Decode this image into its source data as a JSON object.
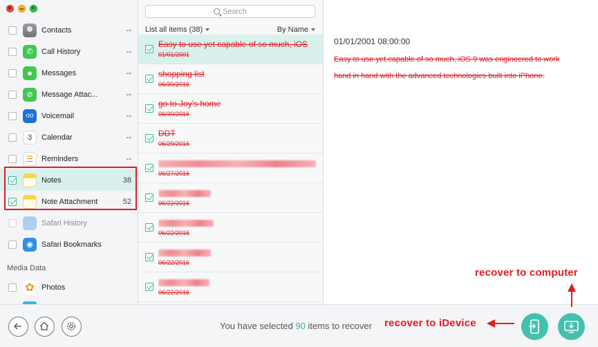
{
  "sidebar": {
    "items": [
      {
        "label": "Contacts",
        "count": "--",
        "checked": false
      },
      {
        "label": "Call History",
        "count": "--",
        "checked": false
      },
      {
        "label": "Messages",
        "count": "--",
        "checked": false
      },
      {
        "label": "Message Attac...",
        "count": "--",
        "checked": false
      },
      {
        "label": "Voicemail",
        "count": "--",
        "checked": false
      },
      {
        "label": "Calendar",
        "count": "--",
        "checked": false
      },
      {
        "label": "Reminders",
        "count": "--",
        "checked": false
      },
      {
        "label": "Notes",
        "count": "38",
        "checked": true
      },
      {
        "label": "Note Attachment",
        "count": "52",
        "checked": true
      },
      {
        "label": "Safari History",
        "count": "--",
        "checked": false
      },
      {
        "label": "Safari Bookmarks",
        "count": "--",
        "checked": false
      },
      {
        "label": "Photos",
        "count": "--",
        "checked": false
      }
    ],
    "section_media": "Media Data",
    "calendar_day": "3"
  },
  "list": {
    "search_placeholder": "Search",
    "header_left": "List all items (38)",
    "header_right": "By Name",
    "rows": [
      {
        "title": "Easy to use yet capable of so much, iOS",
        "date": "01/01/2001"
      },
      {
        "title": "shopping list",
        "date": "06/30/2016"
      },
      {
        "title": "go to Joy's home",
        "date": "06/30/2016"
      },
      {
        "title": "DDT",
        "date": "06/29/2016"
      },
      {
        "title": "",
        "date": "06/27/2016"
      },
      {
        "title": "",
        "date": "06/22/2016"
      },
      {
        "title": "",
        "date": "06/22/2016"
      },
      {
        "title": "",
        "date": "06/22/2016"
      },
      {
        "title": "",
        "date": "06/22/2016"
      },
      {
        "title": "",
        "date": "06/22/2016"
      }
    ]
  },
  "detail": {
    "date": "01/01/2001 08:00:00",
    "body": "Easy to use yet capable of so much, iOS 9 was engineered to work hand in hand with the advanced technologies built into iPhone."
  },
  "bottom": {
    "status_prefix": "You have selected ",
    "status_count": "90",
    "status_suffix": " items to recover"
  },
  "annotations": {
    "recover_device": "recover to iDevice",
    "recover_computer": "recover to computer"
  },
  "colors": {
    "accent": "#44c1ad",
    "annotation_red": "#e01b24",
    "selected_bg": "#d9f1ec"
  }
}
